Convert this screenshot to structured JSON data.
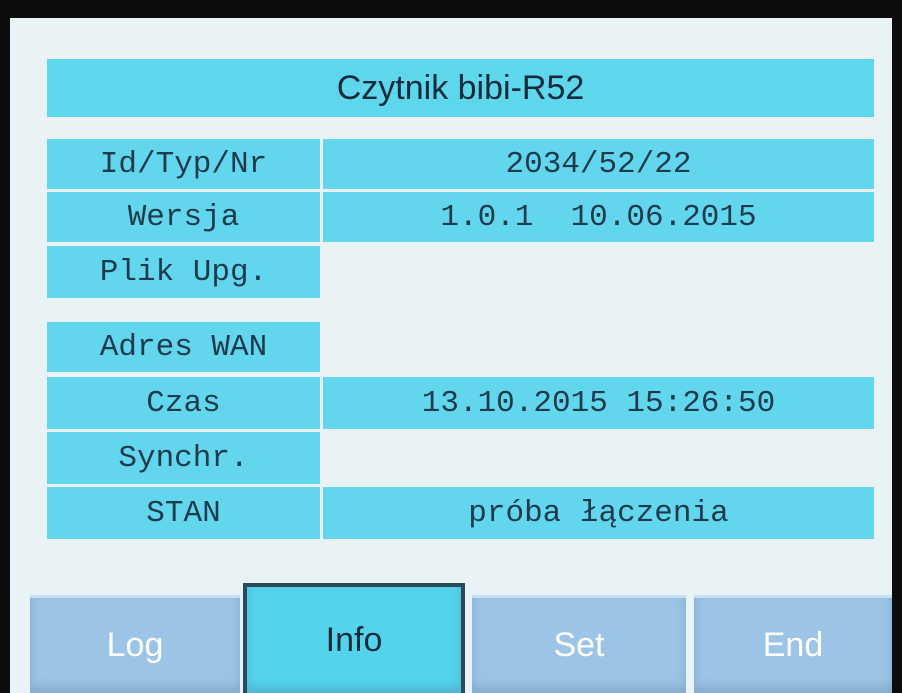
{
  "screen": {
    "title": "Czytnik bibi-R52"
  },
  "info_rows": [
    {
      "label": "Id/Typ/Nr",
      "value": "2034/52/22"
    },
    {
      "label": "Wersja",
      "value": "1.0.1  10.06.2015"
    },
    {
      "label": "Plik Upg.",
      "value": ""
    },
    {
      "label": "Adres WAN",
      "value": ""
    },
    {
      "label": "Czas",
      "value": "13.10.2015 15:26:50"
    },
    {
      "label": "Synchr.",
      "value": ""
    },
    {
      "label": "STAN",
      "value": "próba łączenia"
    }
  ],
  "tabs": {
    "log": "Log",
    "info": "Info",
    "set": "Set",
    "end": "End",
    "active": "Info"
  },
  "colors": {
    "cell_background": "#62d6ec",
    "screen_background": "#e9f3f6",
    "tab_inactive": "#9cc4e6",
    "tab_active": "#54d4ec"
  }
}
